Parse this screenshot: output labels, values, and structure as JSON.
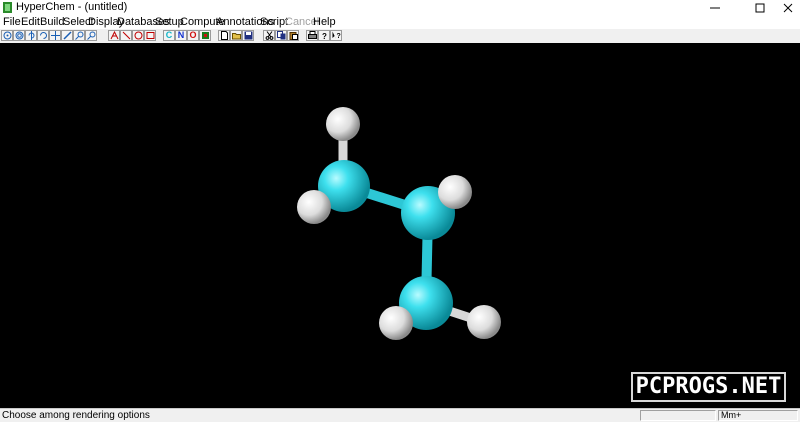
{
  "window": {
    "title": "HyperChem - (untitled)",
    "controls": [
      "minimize-icon",
      "maximize-icon",
      "close-icon"
    ]
  },
  "menu": {
    "items": [
      {
        "label": "File"
      },
      {
        "label": "Edit"
      },
      {
        "label": "Build"
      },
      {
        "label": "Select"
      },
      {
        "label": "Display"
      },
      {
        "label": "Databases"
      },
      {
        "label": "Setup"
      },
      {
        "label": "Compute"
      },
      {
        "label": "Annotations"
      },
      {
        "label": "Script"
      },
      {
        "label": "Cancel",
        "disabled": true
      },
      {
        "label": "Help"
      }
    ]
  },
  "toolbar": {
    "draw_tools": [
      "draw-icon",
      "select-icon",
      "rotate-icon",
      "rotate-z-icon",
      "translate-icon",
      "translate-z-icon",
      "zoom-icon",
      "clip-icon"
    ],
    "annotation_tools": [
      "text-icon",
      "line-icon",
      "ellipse-icon",
      "rectangle-icon"
    ],
    "element_buttons": [
      {
        "label": "C",
        "color": "#12b5c9"
      },
      {
        "label": "N",
        "color": "#1030d0"
      },
      {
        "label": "O",
        "color": "#d01010"
      }
    ],
    "file_tools": [
      "new-icon",
      "open-icon",
      "save-icon"
    ],
    "edit_tools": [
      "cut-icon",
      "copy-icon",
      "paste-icon"
    ],
    "misc_tools": [
      "print-icon",
      "help-icon",
      "context-help-icon"
    ]
  },
  "viewport": {
    "background": "#000000",
    "carbon_color": "#19c7d6",
    "hydrogen_color": "#ffffff"
  },
  "watermark": {
    "text": "PCPROGS.NET"
  },
  "status": {
    "message": "Choose among rendering options",
    "units": "Mm+"
  }
}
